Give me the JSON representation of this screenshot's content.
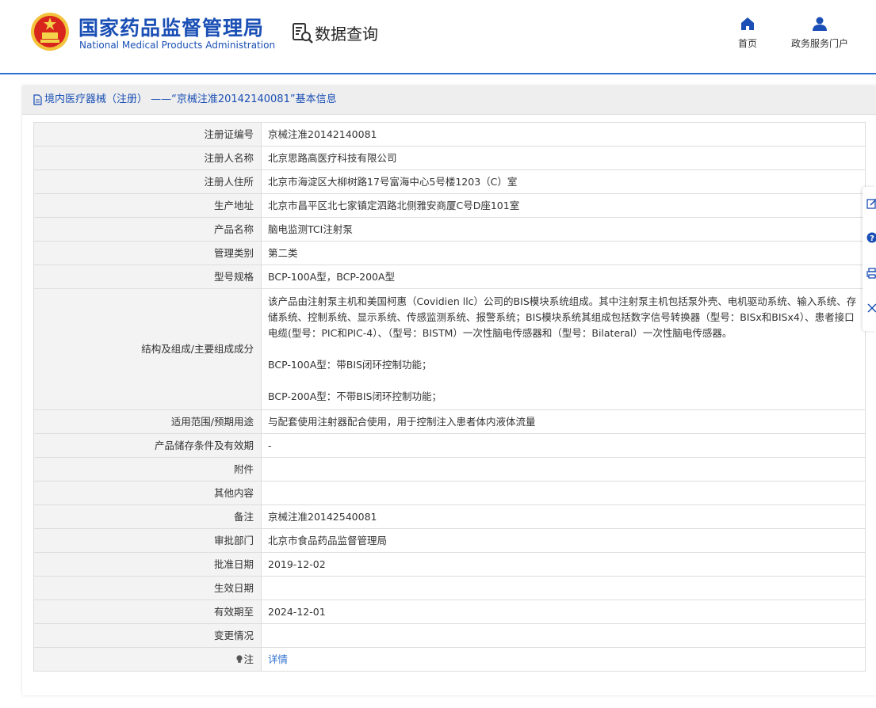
{
  "header": {
    "org_name_cn": "国家药品监督管理局",
    "org_name_en": "National Medical Products Administration",
    "section_title": "数据查询",
    "nav": [
      {
        "label": "首页",
        "icon": "home-icon"
      },
      {
        "label": "政务服务门户",
        "icon": "user-icon"
      }
    ]
  },
  "panel": {
    "title": "境内医疗器械（注册） ——“京械注准20142140081”基本信息"
  },
  "rows": [
    {
      "label": "注册证编号",
      "value": "京械注准20142140081"
    },
    {
      "label": "注册人名称",
      "value": "北京思路高医疗科技有限公司"
    },
    {
      "label": "注册人住所",
      "value": "北京市海淀区大柳树路17号富海中心5号楼1203（C）室"
    },
    {
      "label": "生产地址",
      "value": "北京市昌平区北七家镇定泗路北侧雅安商厦C号D座101室"
    },
    {
      "label": "产品名称",
      "value": "脑电监测TCI注射泵"
    },
    {
      "label": "管理类别",
      "value": "第二类"
    },
    {
      "label": "型号规格",
      "value": "BCP-100A型，BCP-200A型"
    },
    {
      "label": "结构及组成/主要组成成分",
      "paragraphs": [
        "该产品由注射泵主机和美国柯惠（Covidien llc）公司的BIS模块系统组成。其中注射泵主机包括泵外壳、电机驱动系统、输入系统、存储系统、控制系统、显示系统、传感监测系统、报警系统；BIS模块系统其组成包括数字信号转换器（型号：BISx和BISx4）、患者接口电缆(型号：PIC和PIC-4）、（型号：BISTM）一次性脑电传感器和（型号：Bilateral）一次性脑电传感器。",
        "BCP-100A型：带BIS闭环控制功能；",
        "BCP-200A型：不带BIS闭环控制功能；"
      ]
    },
    {
      "label": "适用范围/预期用途",
      "value": "与配套使用注射器配合使用，用于控制注入患者体内液体流量"
    },
    {
      "label": "产品储存条件及有效期",
      "value": "-"
    },
    {
      "label": "附件",
      "value": ""
    },
    {
      "label": "其他内容",
      "value": ""
    },
    {
      "label": "备注",
      "value": "京械注准20142540081"
    },
    {
      "label": "审批部门",
      "value": "北京市食品药品监督管理局"
    },
    {
      "label": "批准日期",
      "value": "2019-12-02"
    },
    {
      "label": "生效日期",
      "value": ""
    },
    {
      "label": "有效期至",
      "value": "2024-12-01"
    },
    {
      "label": "变更情况",
      "value": ""
    },
    {
      "label": "注",
      "icon": "lightbulb-icon",
      "link": "详情"
    }
  ],
  "side_tools": [
    "edit-icon",
    "help-icon",
    "print-icon",
    "close-icon"
  ],
  "colors": {
    "brand": "#1a4fb5",
    "accent": "#2e6fd0",
    "label_bg": "#f3f3f3",
    "border": "#dddddd"
  }
}
